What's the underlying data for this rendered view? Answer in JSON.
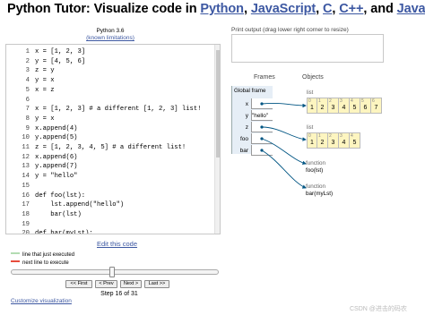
{
  "header": {
    "prefix": "Python Tutor: Visualize code in ",
    "langs": [
      "Python",
      "JavaScript",
      "C",
      "C++"
    ],
    "and": "and",
    "last_lang": "Java"
  },
  "editor": {
    "python_version": "Python 3.6",
    "known_limitations": "(known limitations)",
    "lines": [
      {
        "n": "1",
        "code": "x = [1, 2, 3]"
      },
      {
        "n": "2",
        "code": "y = [4, 5, 6]"
      },
      {
        "n": "3",
        "code": "z = y"
      },
      {
        "n": "4",
        "code": "y = x"
      },
      {
        "n": "5",
        "code": "x = z"
      },
      {
        "n": "6",
        "code": ""
      },
      {
        "n": "7",
        "code": "x = [1, 2, 3] # a different [1, 2, 3] list!"
      },
      {
        "n": "8",
        "code": "y = x"
      },
      {
        "n": "9",
        "code": "x.append(4)"
      },
      {
        "n": "10",
        "code": "y.append(5)"
      },
      {
        "n": "11",
        "code": "z = [1, 2, 3, 4, 5] # a different list!"
      },
      {
        "n": "12",
        "code": "x.append(6)"
      },
      {
        "n": "13",
        "code": "y.append(7)"
      },
      {
        "n": "14",
        "code": "y = \"hello\""
      },
      {
        "n": "15",
        "code": ""
      },
      {
        "n": "16",
        "code": "def foo(lst):"
      },
      {
        "n": "17",
        "code": "    lst.append(\"hello\")"
      },
      {
        "n": "18",
        "code": "    bar(lst)"
      },
      {
        "n": "19",
        "code": ""
      },
      {
        "n": "20",
        "code": "def bar(myLst):"
      }
    ],
    "edit_link": "Edit this code"
  },
  "legend": {
    "just_executed": "line that just executed",
    "next_line": "next line to execute"
  },
  "controls": {
    "first": "<< First",
    "prev": "< Prev",
    "next": "Next >",
    "last": "Last >>",
    "step": "Step 16 of 31",
    "slider_position": 0.48,
    "customize": "Customize visualization"
  },
  "output": {
    "label": "Print output (drag lower right corner to resize)",
    "text": ""
  },
  "viz": {
    "frames_title": "Frames",
    "objects_title": "Objects",
    "frame_name": "Global frame",
    "vars": [
      "x",
      "y",
      "z",
      "foo",
      "bar"
    ],
    "y_value": "\"hello\"",
    "list_label": "list",
    "list1": [
      "1",
      "2",
      "3",
      "4",
      "5",
      "6",
      "7"
    ],
    "list2": [
      "1",
      "2",
      "3",
      "4",
      "5"
    ],
    "idx1": [
      "0",
      "1",
      "2",
      "3",
      "4",
      "5",
      "6"
    ],
    "idx2": [
      "0",
      "1",
      "2",
      "3",
      "4"
    ],
    "func_kw": "function",
    "foo_sig": "foo(lst)",
    "bar_sig": "bar(myLst)"
  },
  "watermark": "CSDN @进击的码农",
  "colors": {
    "link": "#3d58a2",
    "frame_bg": "#e6eef6",
    "list_bg": "#fdf5c0",
    "just_executed": "#b3dcb2",
    "next_line": "#e74c3c"
  }
}
